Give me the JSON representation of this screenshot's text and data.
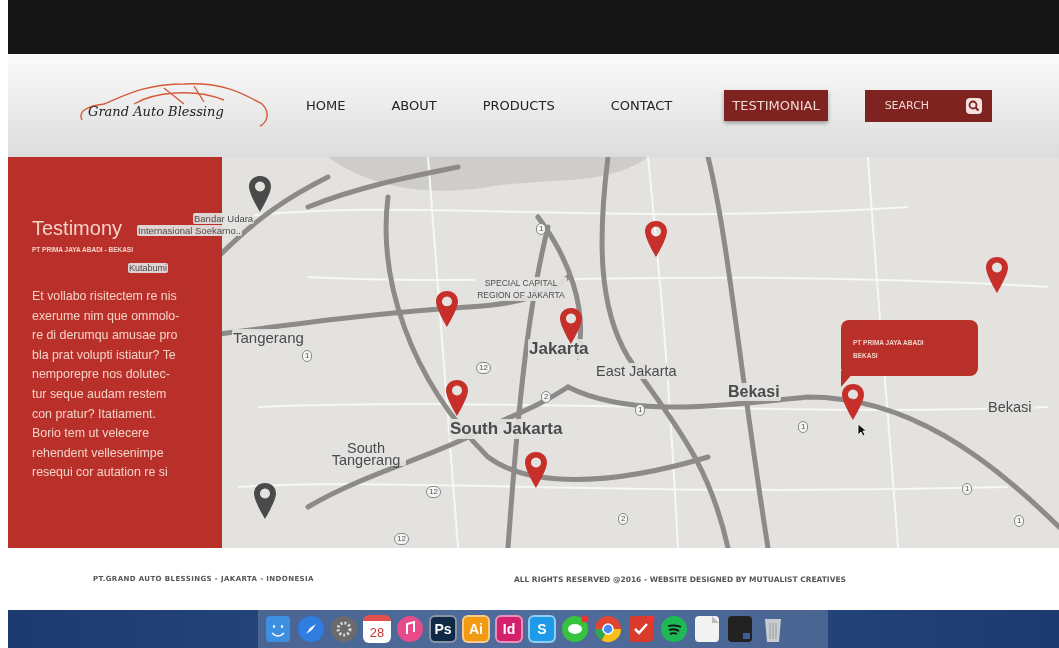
{
  "header": {
    "logo": "Grand Auto Blessing",
    "nav": [
      {
        "label": "HOME",
        "selected": false
      },
      {
        "label": "ABOUT",
        "selected": false
      },
      {
        "label": "PRODUCTS",
        "selected": false
      },
      {
        "label": "CONTACT",
        "selected": false
      },
      {
        "label": "TESTIMONIAL",
        "selected": true
      }
    ],
    "search": {
      "label": "SEARCH"
    }
  },
  "testimony": {
    "title": "Testimony",
    "subtitle": "PT PRIMA JAYA ABADI - BEKASI",
    "lines": [
      "Et vollabo risitectem re nis",
      "exerume nim que ommolo-",
      "re di derumqu amusae pro",
      "bla prat volupti istiatur? Te",
      "nemporepre nos dolutec-",
      "tur seque audam restem",
      "con pratur? Itatiament.",
      "Borio tem ut velecere",
      "rehendent vellesenimpe",
      "resequi cor autation re si"
    ]
  },
  "map": {
    "labels": [
      "Bandar Udara",
      "Internasional Soekarno..",
      "Kutabumi",
      "SPECIAL CAPITAL REGION OF JAKARTA",
      "Tangerang",
      "Jakarta",
      "East Jakarta",
      "Bekasi",
      "Bekasi",
      "South Jakarta",
      "South Tangerang"
    ],
    "road_shields": [
      "1",
      "1",
      "12",
      "2",
      "1",
      "1",
      "12",
      "2",
      "1",
      "1",
      "12"
    ],
    "pins": [
      {
        "color": "#4a4a4a"
      },
      {
        "color": "#c62f2a"
      },
      {
        "color": "#c62f2a"
      },
      {
        "color": "#c62f2a"
      },
      {
        "color": "#c62f2a"
      },
      {
        "color": "#c62f2a"
      },
      {
        "color": "#c62f2a"
      },
      {
        "color": "#c62f2a"
      },
      {
        "color": "#4a4a4a"
      }
    ],
    "popup": {
      "lines": [
        "PT PRIMA JAYA ABADI",
        "BEKASI"
      ]
    }
  },
  "footer": {
    "left": "PT.GRAND AUTO BLESSINGS - JAKARTA - INDONESIA",
    "right": "ALL RIGHTS RESERVED @2016 - WEBSITE DESIGNED BY MUTUALIST CREATIVES"
  },
  "dock": [
    {
      "kind": "finder",
      "color": "#3d8fe0"
    },
    {
      "kind": "compass",
      "color": "#2f7de1"
    },
    {
      "kind": "gear",
      "color": "#6b6b6b"
    },
    {
      "kind": "calendar",
      "color": "#ffffff",
      "label": "28"
    },
    {
      "kind": "music",
      "color": "#e84b8a"
    },
    {
      "kind": "label",
      "color": "#0e2a47",
      "label": "Ps"
    },
    {
      "kind": "label",
      "color": "#f29b12",
      "label": "Ai"
    },
    {
      "kind": "label",
      "color": "#d4216e",
      "label": "Id"
    },
    {
      "kind": "label",
      "color": "#1e9be8",
      "label": "S"
    },
    {
      "kind": "chat",
      "color": "#37c33d"
    },
    {
      "kind": "chrome",
      "color": "#e0452f"
    },
    {
      "kind": "check",
      "color": "#d93a2b"
    },
    {
      "kind": "spotify",
      "color": "#1db954"
    },
    {
      "kind": "doc",
      "color": "#f3f3f3"
    },
    {
      "kind": "screen",
      "color": "#222222"
    },
    {
      "kind": "trash",
      "color": "#c9ccd0"
    }
  ]
}
